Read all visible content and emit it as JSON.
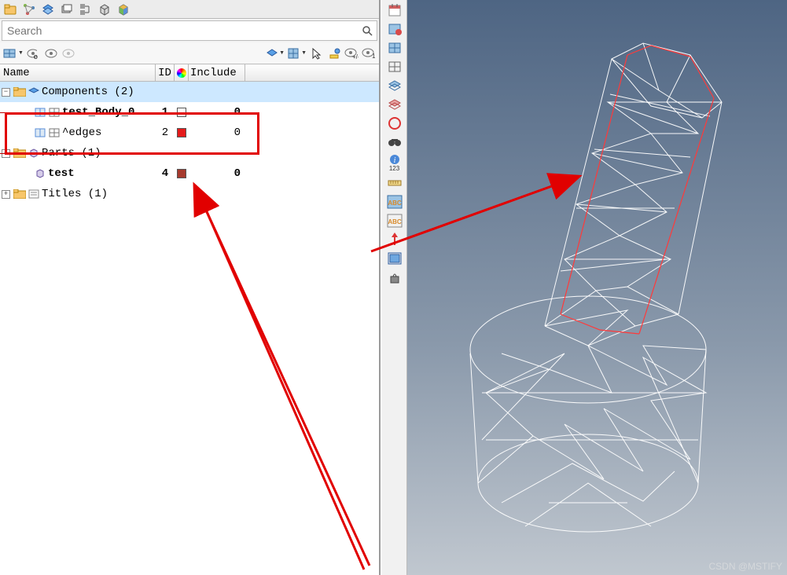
{
  "search": {
    "placeholder": "Search"
  },
  "headers": {
    "name": "Name",
    "id": "ID",
    "include": "Include"
  },
  "tree": {
    "components_label": "Components (2)",
    "comp1": {
      "name": "test_Body_0",
      "id": "1",
      "inc": "0",
      "color": "#ffffff"
    },
    "comp2": {
      "name": "^edges",
      "id": "2",
      "inc": "0",
      "color": "#e41b1b"
    },
    "parts_label": "Parts (1)",
    "part1": {
      "name": "test",
      "id": "4",
      "inc": "0",
      "color": "#a63a2e"
    },
    "titles_label": "Titles (1)"
  },
  "midbar": {
    "items": [
      "cal",
      "pattern",
      "pattern2",
      "grid",
      "grid2",
      "layers",
      "circle",
      "binoc",
      "info-123",
      "ruler",
      "abc-grid",
      "abc-grid2",
      "text-red",
      "frame-blue",
      "weight"
    ]
  },
  "watermark": "CSDN @MSTIFY"
}
